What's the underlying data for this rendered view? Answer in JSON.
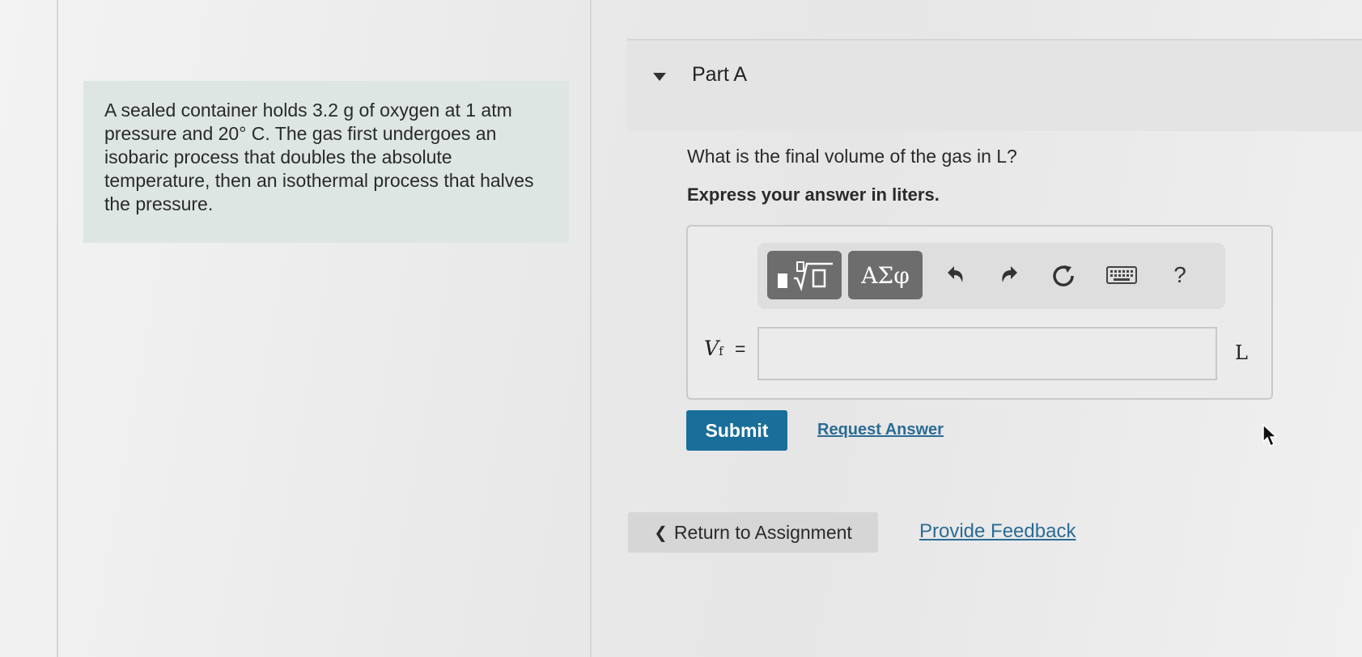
{
  "problem": {
    "text": "A sealed container holds 3.2 g of oxygen at 1 atm pressure and 20° C. The gas first undergoes an isobaric process that doubles the absolute temperature, then an isothermal process that halves the pressure."
  },
  "part": {
    "title": "Part A",
    "question": "What is the final volume of the gas in L?",
    "instruction": "Express your answer in liters."
  },
  "toolbar": {
    "greek_label": "ΑΣφ",
    "help_label": "?",
    "icons": [
      "templates-icon",
      "undo-icon",
      "redo-icon",
      "reset-icon",
      "keyboard-icon",
      "help-icon"
    ]
  },
  "answer": {
    "variable": "V",
    "subscript": "f",
    "equals": "=",
    "value": "",
    "unit": "L"
  },
  "actions": {
    "submit_label": "Submit",
    "request_answer_label": "Request Answer",
    "return_label": "Return to Assignment",
    "feedback_label": "Provide Feedback"
  },
  "colors": {
    "submit_bg": "#1a6e9a",
    "link": "#2a6c95",
    "problem_bg": "#dde6e3",
    "toolbar_button": "#6d6d6d"
  }
}
